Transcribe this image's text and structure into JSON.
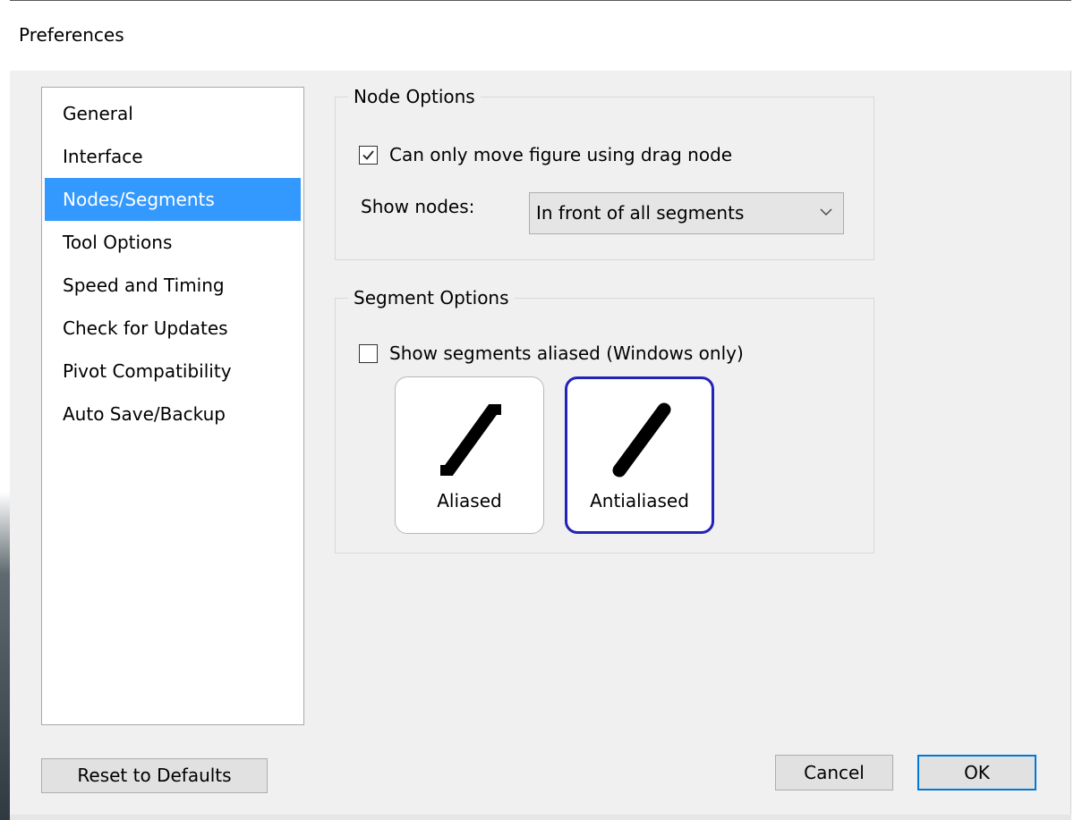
{
  "window": {
    "title": "Preferences"
  },
  "sidebar": {
    "items": [
      {
        "label": "General",
        "selected": false
      },
      {
        "label": "Interface",
        "selected": false
      },
      {
        "label": "Nodes/Segments",
        "selected": true
      },
      {
        "label": "Tool Options",
        "selected": false
      },
      {
        "label": "Speed and Timing",
        "selected": false
      },
      {
        "label": "Check for Updates",
        "selected": false
      },
      {
        "label": "Pivot Compatibility",
        "selected": false
      },
      {
        "label": "Auto Save/Backup",
        "selected": false
      }
    ]
  },
  "node_options": {
    "legend": "Node Options",
    "drag_node_checkbox": {
      "label": "Can only move figure using drag node",
      "checked": true
    },
    "show_nodes_label": "Show nodes:",
    "show_nodes_value": "In front of all segments"
  },
  "segment_options": {
    "legend": "Segment Options",
    "aliased_checkbox": {
      "label": "Show segments aliased (Windows only)",
      "checked": false
    },
    "aliased_button_label": "Aliased",
    "antialiased_button_label": "Antialiased",
    "selected_style": "Antialiased"
  },
  "footer": {
    "reset_label": "Reset to Defaults",
    "cancel_label": "Cancel",
    "ok_label": "OK"
  },
  "colors": {
    "selection": "#3399ff",
    "window_bg": "#f0f0f0",
    "default_button_border": "#0078d7",
    "selected_style_border": "#2323b8"
  },
  "icons": {
    "checkbox_checked": "checkmark-icon",
    "select_arrow": "chevron-down-icon",
    "aliased_preview": "aliased-line-icon",
    "antialiased_preview": "antialiased-line-icon"
  }
}
